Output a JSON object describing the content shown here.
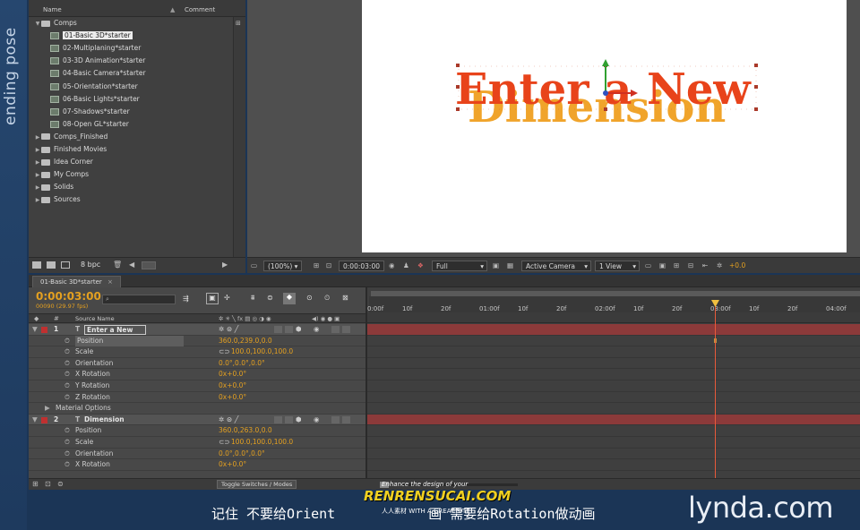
{
  "side_label": "ending pose",
  "project": {
    "col_name": "Name",
    "col_comment": "Comment",
    "items": [
      {
        "type": "folder-open",
        "label": "Comps",
        "indent": 0
      },
      {
        "type": "comp",
        "label": "01-Basic 3D*starter",
        "indent": 1,
        "selected": true
      },
      {
        "type": "comp",
        "label": "02-Multiplaning*starter",
        "indent": 1
      },
      {
        "type": "comp",
        "label": "03-3D Animation*starter",
        "indent": 1
      },
      {
        "type": "comp",
        "label": "04-Basic Camera*starter",
        "indent": 1
      },
      {
        "type": "comp",
        "label": "05-Orientation*starter",
        "indent": 1
      },
      {
        "type": "comp",
        "label": "06-Basic Lights*starter",
        "indent": 1
      },
      {
        "type": "comp",
        "label": "07-Shadows*starter",
        "indent": 1
      },
      {
        "type": "comp",
        "label": "08-Open GL*starter",
        "indent": 1
      },
      {
        "type": "folder",
        "label": "Comps_Finished",
        "indent": 0
      },
      {
        "type": "folder",
        "label": "Finished Movies",
        "indent": 0
      },
      {
        "type": "folder",
        "label": "Idea Corner",
        "indent": 0
      },
      {
        "type": "folder",
        "label": "My Comps",
        "indent": 0
      },
      {
        "type": "folder",
        "label": "Solids",
        "indent": 0
      },
      {
        "type": "folder",
        "label": "Sources",
        "indent": 0
      }
    ],
    "bpc": "8 bpc"
  },
  "viewer": {
    "title_line1": "Enter a New",
    "title_line2": "Dimension",
    "zoom": "(100%)",
    "timecode": "0:00:03:00",
    "resolution": "Full",
    "camera": "Active Camera",
    "views": "1 View",
    "exposure": "+0.0"
  },
  "timeline": {
    "tab": "01-Basic 3D*starter",
    "current_time": "0:00:03:00",
    "frame_info": "00090 (29.97 fps)",
    "col_source": "Source Name",
    "ruler": [
      "0:00f",
      "10f",
      "20f",
      "01:00f",
      "10f",
      "20f",
      "02:00f",
      "10f",
      "20f",
      "03:00f",
      "10f",
      "20f",
      "04:00f"
    ],
    "rows": [
      {
        "kind": "layer",
        "num": "1",
        "name": "Enter a New"
      },
      {
        "kind": "prop",
        "name": "Position",
        "value": "360.0,239.0,0.0",
        "selected": true
      },
      {
        "kind": "prop",
        "name": "Scale",
        "value": "100.0,100.0,100.0",
        "link": true
      },
      {
        "kind": "prop",
        "name": "Orientation",
        "value": "0.0°,0.0°,0.0°"
      },
      {
        "kind": "prop",
        "name": "X Rotation",
        "value": "0x+0.0°"
      },
      {
        "kind": "prop",
        "name": "Y Rotation",
        "value": "0x+0.0°"
      },
      {
        "kind": "prop",
        "name": "Z Rotation",
        "value": "0x+0.0°"
      },
      {
        "kind": "group",
        "name": "Material Options"
      },
      {
        "kind": "layer",
        "num": "2",
        "name": "Dimension"
      },
      {
        "kind": "prop",
        "name": "Position",
        "value": "360.0,263.0,0.0"
      },
      {
        "kind": "prop",
        "name": "Scale",
        "value": "100.0,100.0,100.0",
        "link": true
      },
      {
        "kind": "prop",
        "name": "Orientation",
        "value": "0.0°,0.0°,0.0°"
      },
      {
        "kind": "prop",
        "name": "X Rotation",
        "value": "0x+0.0°"
      }
    ],
    "toggle_label": "Toggle Switches / Modes"
  },
  "caption": "记住 不要给Orient",
  "caption_tail": "画 需要给Rotation做动画",
  "watermark_line1": "Enhance the design of your",
  "watermark_line2": "RENRENSUCAI.COM",
  "watermark_line3": "人人素材 WITH A GREAT SITE",
  "brand": "lynda.com",
  "colors": {
    "accent_orange": "#e4a020",
    "layer_bar_red": "#8c3a3a",
    "title_red": "#e8431a",
    "title_yellow": "#f0a020"
  }
}
